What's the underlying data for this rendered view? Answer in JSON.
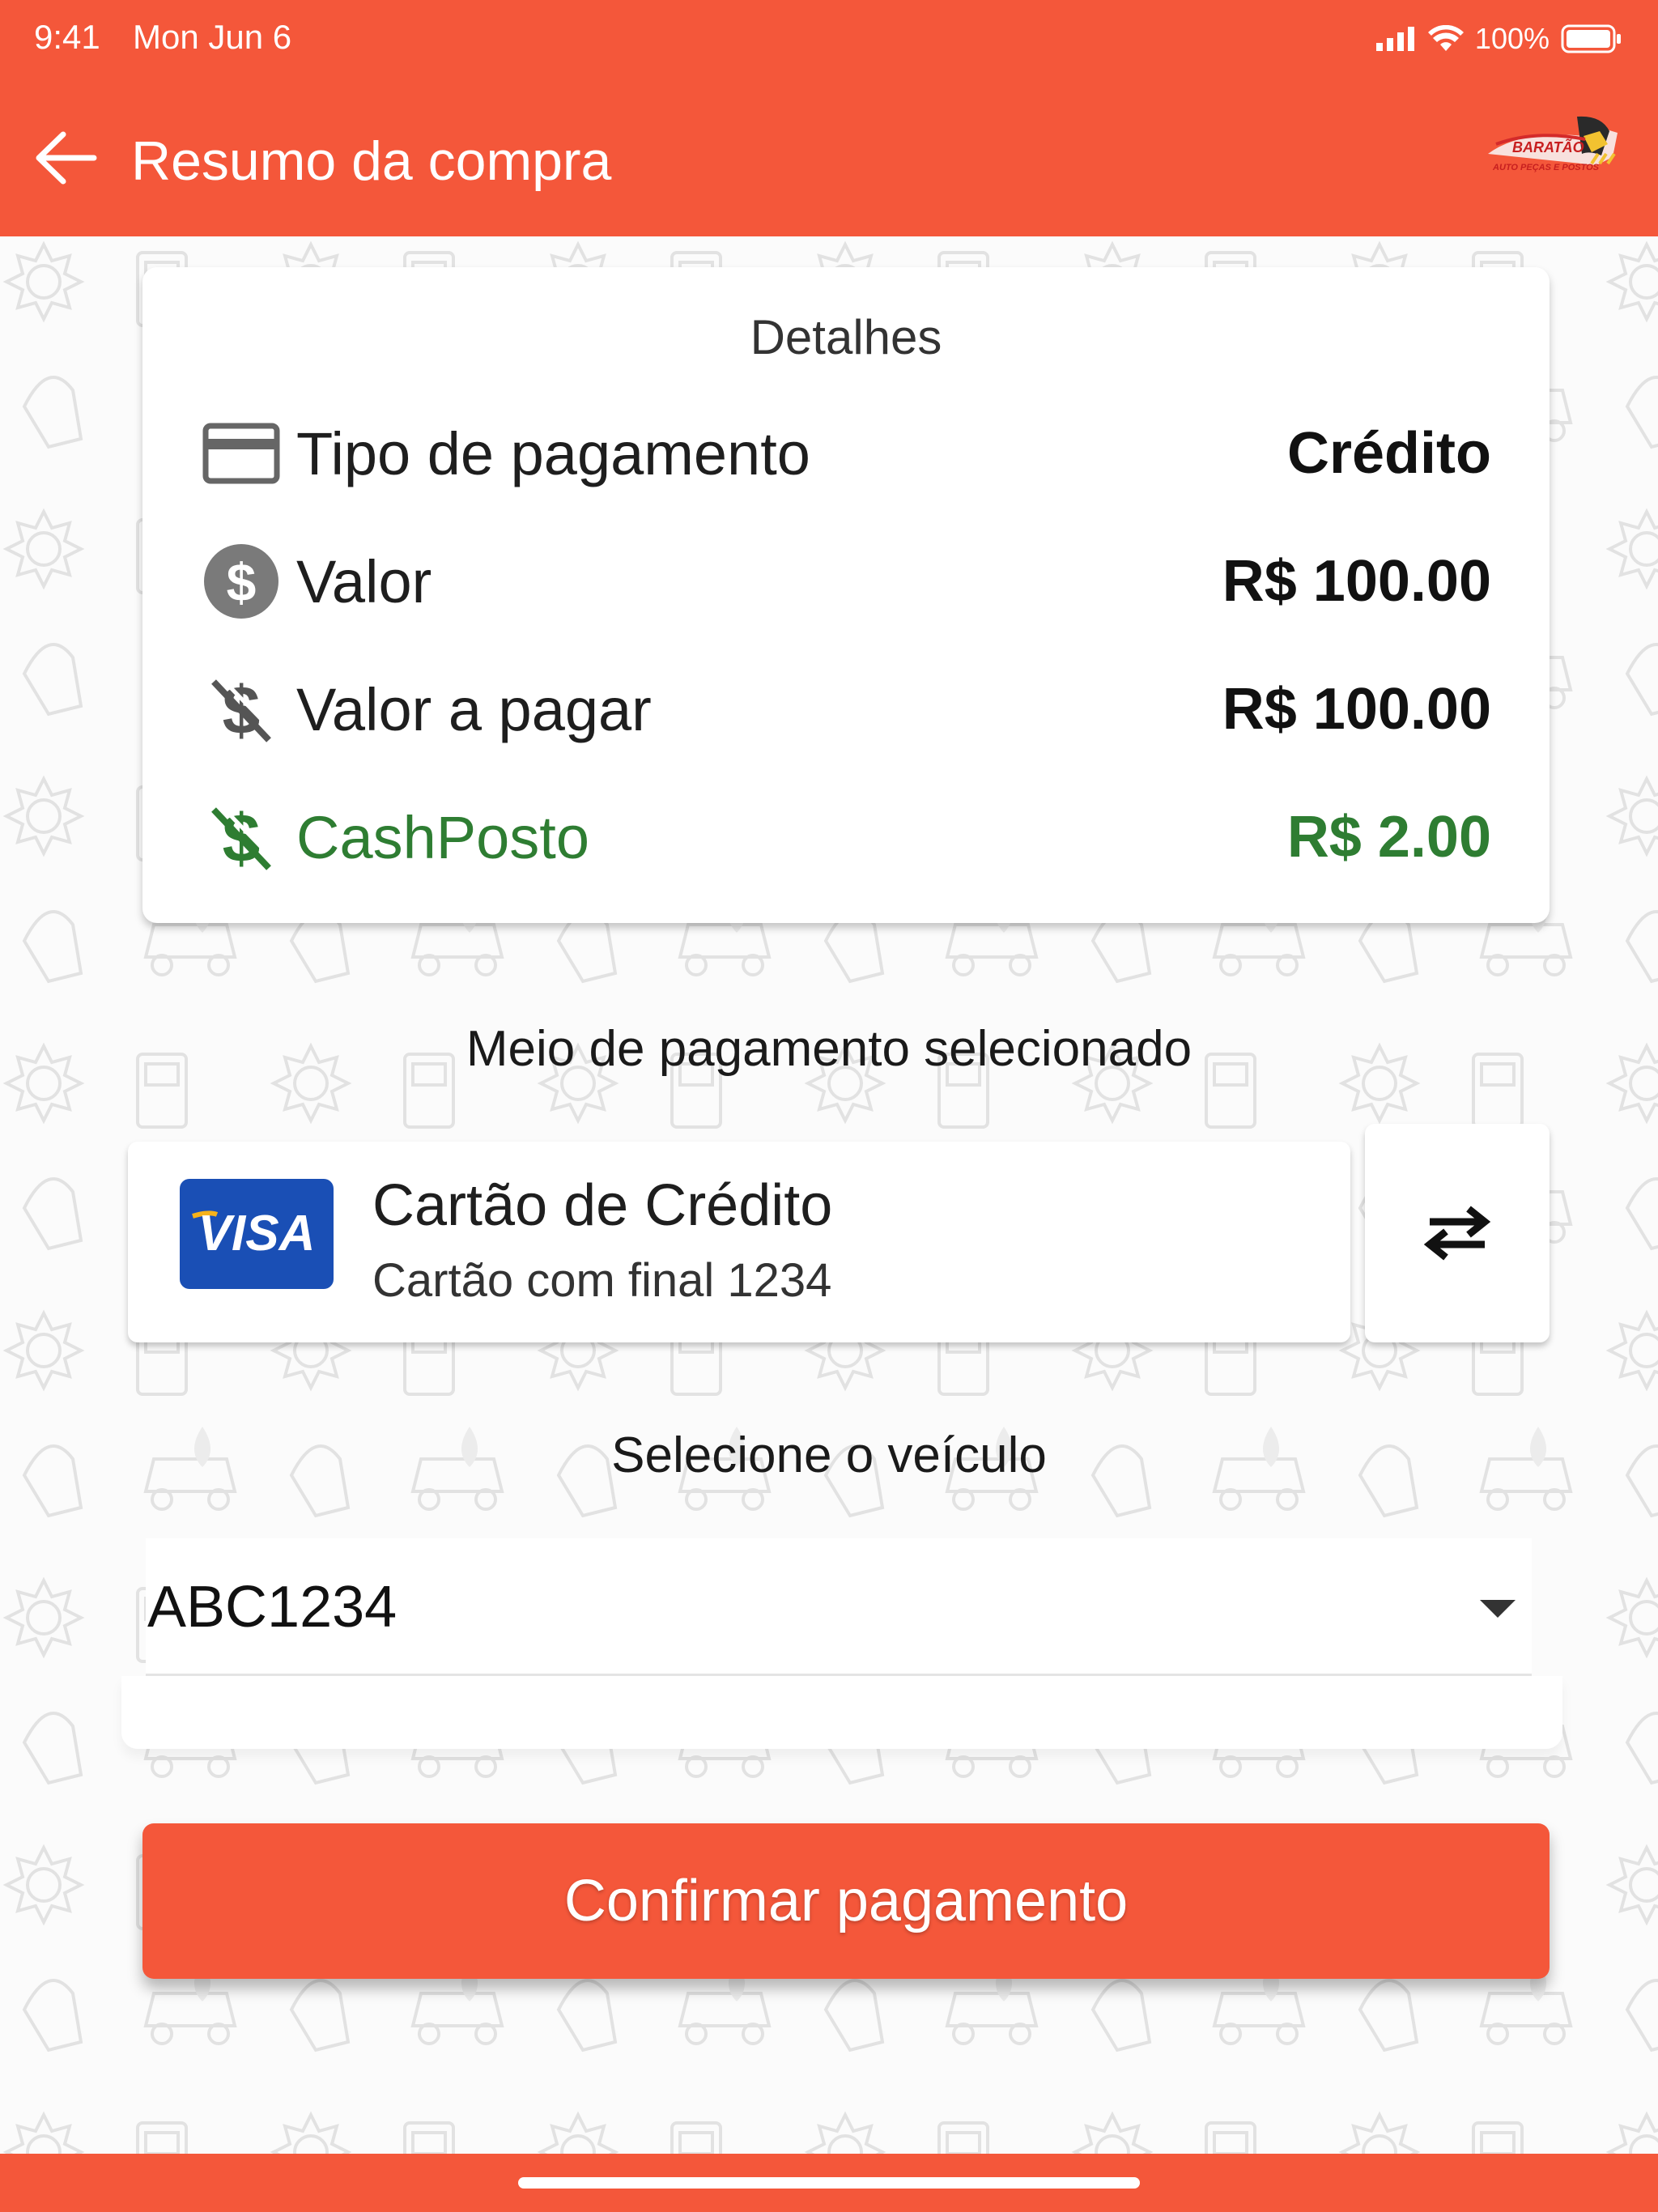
{
  "status_bar": {
    "time": "9:41",
    "date": "Mon Jun 6",
    "battery": "100%"
  },
  "header": {
    "title": "Resumo da compra",
    "logo_text_main": "BARATÃO",
    "logo_text_sub": "AUTO PEÇAS E POSTOS"
  },
  "details": {
    "title": "Detalhes",
    "rows": [
      {
        "icon": "credit-card-icon",
        "label": "Tipo de pagamento",
        "value": "Crédito"
      },
      {
        "icon": "dollar-circle-icon",
        "label": "Valor",
        "value": "R$ 100.00"
      },
      {
        "icon": "dollar-off-icon",
        "label": "Valor a pagar",
        "value": "R$ 100.00"
      },
      {
        "icon": "cashback-dollar-icon",
        "label": "CashPosto",
        "value": "R$ 2.00"
      }
    ]
  },
  "payment": {
    "section_title": "Meio de pagamento selecionado",
    "card_name": "Cartão de Crédito",
    "card_detail": "Cartão com final 1234",
    "brand": "VISA"
  },
  "vehicle": {
    "section_title": "Selecione o veículo",
    "selected": "ABC1234"
  },
  "actions": {
    "confirm_label": "Confirmar pagamento"
  },
  "colors": {
    "primary": "#f4573a",
    "cash_green": "#2e7d32",
    "visa_blue": "#1a4fb5"
  }
}
